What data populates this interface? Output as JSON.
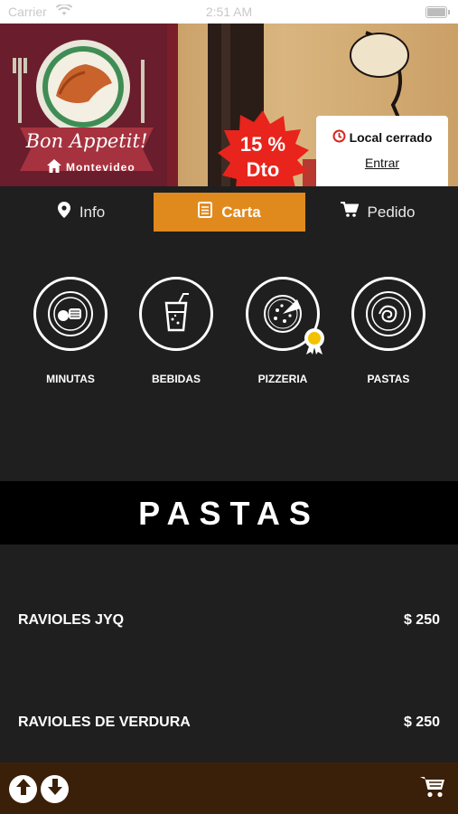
{
  "status_bar": {
    "carrier": "Carrier",
    "time": "2:51 AM"
  },
  "banner": {
    "brand": "Bon Appetit!",
    "location": "Montevideo",
    "discount_line1": "15 %",
    "discount_line2": "Dto",
    "status_text": "Local cerrado",
    "enter_link": "Entrar"
  },
  "tabs": [
    {
      "label": "Info",
      "icon": "location-pin-icon",
      "active": false
    },
    {
      "label": "Carta",
      "icon": "menu-list-icon",
      "active": true
    },
    {
      "label": "Pedido",
      "icon": "cart-icon",
      "active": false
    }
  ],
  "categories": [
    {
      "label": "MINUTAS",
      "icon": "plate-food-icon"
    },
    {
      "label": "BEBIDAS",
      "icon": "drink-glass-icon"
    },
    {
      "label": "PIZZERIA",
      "icon": "pizza-icon"
    },
    {
      "label": "PASTAS",
      "icon": "pasta-bowl-icon"
    }
  ],
  "section_title": "PASTAS",
  "items": [
    {
      "name": "RAVIOLES JYQ",
      "price": "$ 250"
    },
    {
      "name": "RAVIOLES DE VERDURA",
      "price": "$ 250"
    }
  ],
  "colors": {
    "accent": "#e08a1d",
    "background": "#1f1f1f",
    "footer": "#3a2009",
    "discount": "#e8241c"
  }
}
